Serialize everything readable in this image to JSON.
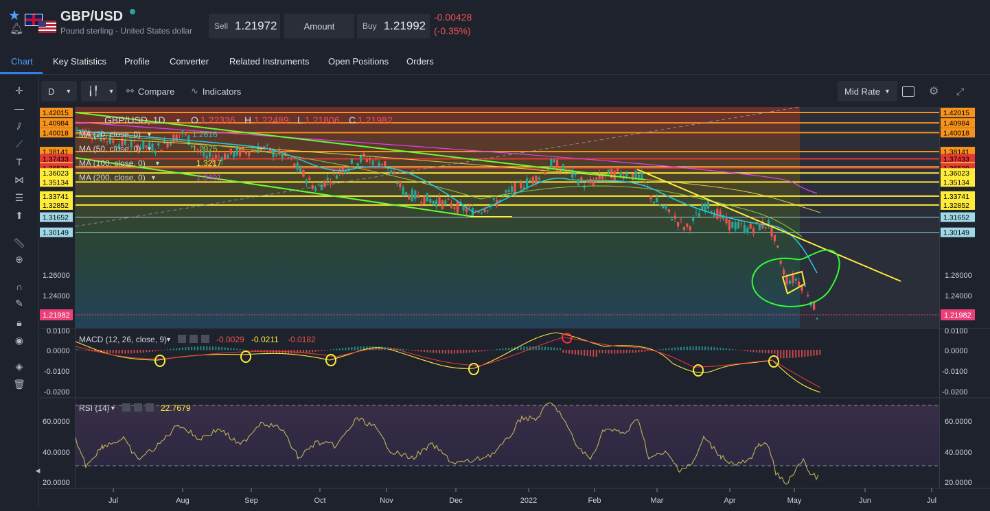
{
  "instrument": {
    "symbol": "GBP/USD",
    "name": "Pound sterling - United States dollar",
    "sell_label": "Sell",
    "sell_price": "1.21972",
    "amount_label": "Amount",
    "buy_label": "Buy",
    "buy_price": "1.21992",
    "change_abs": "-0.00428",
    "change_pct": "(-0.35%)"
  },
  "tabs": [
    "Chart",
    "Key Statistics",
    "Profile",
    "Converter",
    "Related Instruments",
    "Open Positions",
    "Orders"
  ],
  "toolbar": {
    "interval": "D",
    "compare_label": "Compare",
    "indicators_label": "Indicators",
    "rate_label": "Mid Rate"
  },
  "legend": {
    "title": "GBP/USD, 1D",
    "o_label": "O",
    "o_value": "1.22336",
    "h_label": "H",
    "h_value": "1.22489",
    "l_label": "L",
    "l_value": "1.21806",
    "c_label": "C",
    "c_value": "1.21982",
    "ma": [
      {
        "label": "MA (20, close, 0)",
        "value": "1.2616",
        "color": "#26c6da"
      },
      {
        "label": "MA (50, close, 0)",
        "value": "1.2975",
        "color": "#8bc34a"
      },
      {
        "label": "MA (100, close, 0)",
        "value": "1.3217",
        "color": "#ffeb3b"
      },
      {
        "label": "MA (200, close, 0)",
        "value": "1.3401",
        "color": "#e040fb"
      }
    ]
  },
  "price_levels": [
    {
      "label": "1.42015",
      "color": "#f7931a"
    },
    {
      "label": "1.40984",
      "color": "#f7931a"
    },
    {
      "label": "1.40018",
      "color": "#f7931a"
    },
    {
      "label": "1.38141",
      "color": "#f7931a"
    },
    {
      "label": "1.37433",
      "color": "#e53935"
    },
    {
      "label": "1.36614",
      "color": "#ffeb3b"
    },
    {
      "label": "1.36529",
      "color": "#e53935"
    },
    {
      "label": "1.36023",
      "color": "#ffeb3b"
    },
    {
      "label": "1.35134",
      "color": "#ffeb3b"
    },
    {
      "label": "1.33741",
      "color": "#ffeb3b"
    },
    {
      "label": "1.32852",
      "color": "#ffeb3b"
    },
    {
      "label": "1.31652",
      "color": "#9fd8e6"
    },
    {
      "label": "1.30149",
      "color": "#9fd8e6"
    }
  ],
  "price_ticks": [
    "1.26000",
    "1.24000"
  ],
  "current_price": "1.21982",
  "macd": {
    "label": "MACD (12, 26, close, 9)",
    "v1": "-0.0029",
    "v2": "-0.0211",
    "v3": "-0.0182",
    "ticks": [
      "0.0100",
      "0.0000",
      "-0.0100",
      "-0.0200"
    ]
  },
  "rsi": {
    "label": "RSI (14)",
    "value": "22.7679",
    "ticks": [
      "60.0000",
      "40.0000",
      "20.0000"
    ]
  },
  "x_axis": [
    "Jul",
    "Aug",
    "Sep",
    "Oct",
    "Nov",
    "Dec",
    "2022",
    "Feb",
    "Mar",
    "Apr",
    "May",
    "Jun",
    "Jul"
  ],
  "colors": {
    "up": "#26a69a",
    "down": "#ef5350",
    "accent": "#2f80ed",
    "trendline": "#ffeb3b",
    "channel": "#4caf50"
  }
}
